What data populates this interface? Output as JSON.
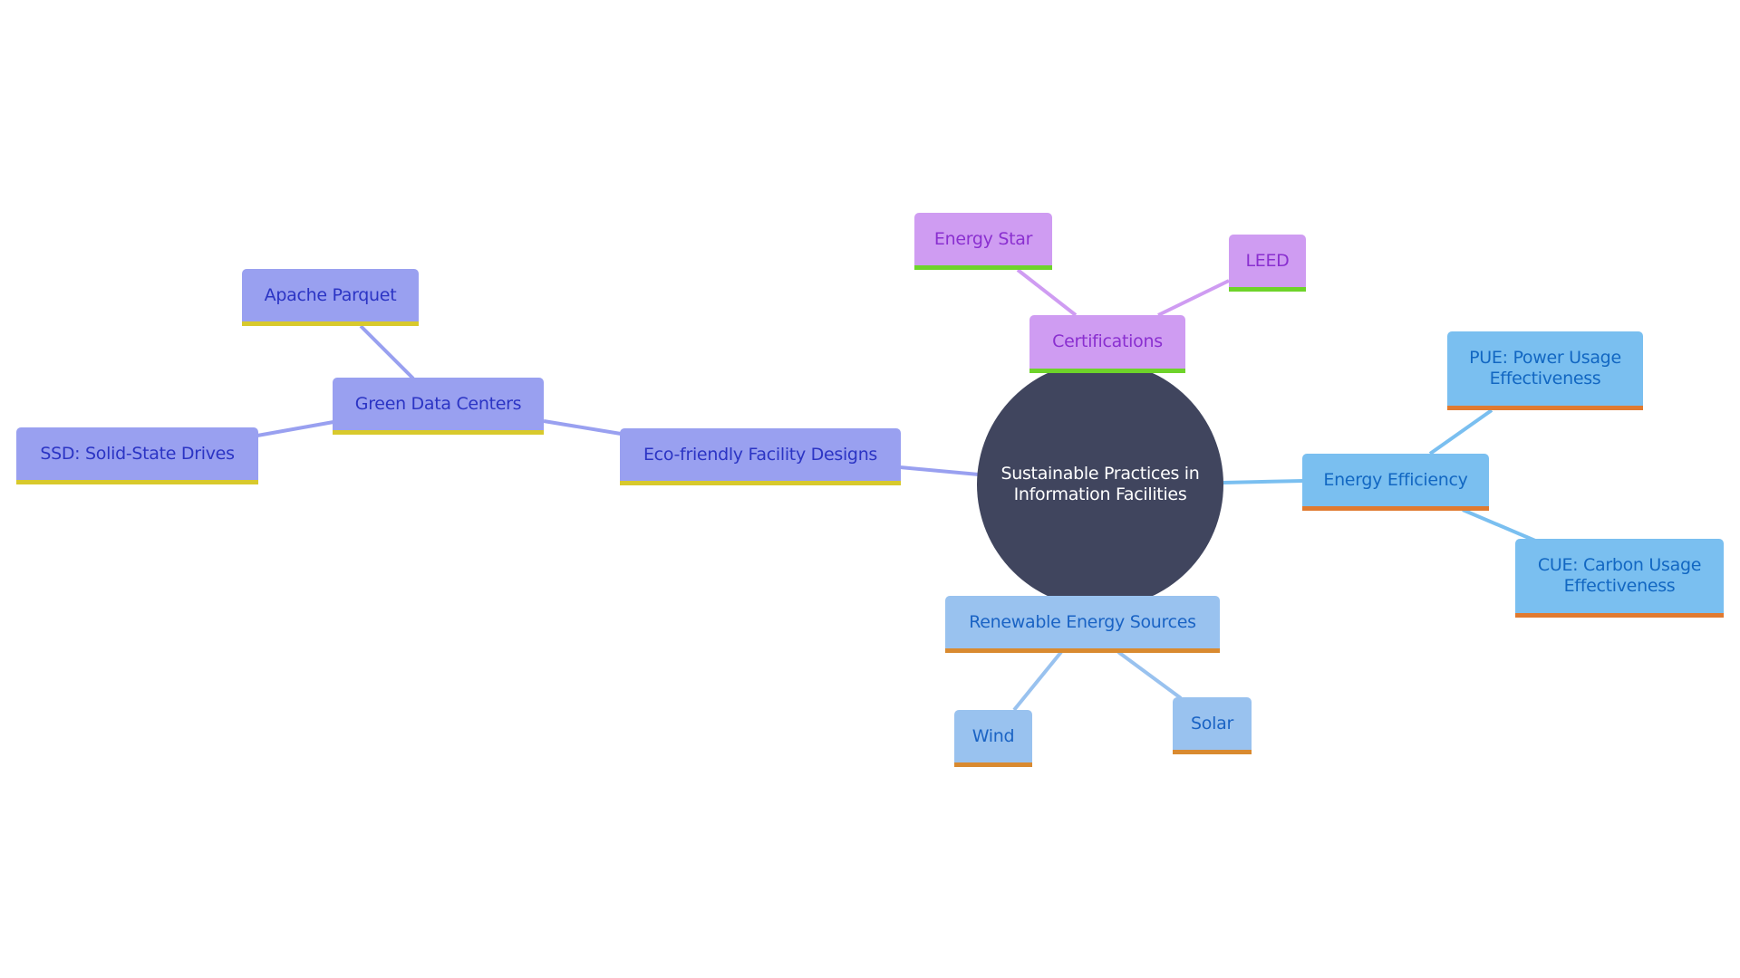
{
  "diagram": {
    "type": "mindmap",
    "root": {
      "label": "Sustainable Practices in Information Facilities",
      "color": "#40455e",
      "text_color": "#ffffff"
    },
    "branches": [
      {
        "id": "eco",
        "label": "Eco-friendly Facility Designs",
        "fill": "#99a0f0",
        "text_color": "#2b34c4",
        "bar": "#d8c92c",
        "edge": "#99a0f0",
        "children": [
          {
            "id": "green",
            "label": "Green Data Centers",
            "children": [
              {
                "id": "parquet",
                "label": "Apache Parquet"
              },
              {
                "id": "ssd",
                "label": "SSD: Solid-State Drives"
              }
            ]
          }
        ]
      },
      {
        "id": "cert",
        "label": "Certifications",
        "fill": "#cf9cf2",
        "text_color": "#8a2fd0",
        "bar": "#6ed32a",
        "edge": "#cf9cf2",
        "children": [
          {
            "id": "estar",
            "label": "Energy Star"
          },
          {
            "id": "leed",
            "label": "LEED"
          }
        ]
      },
      {
        "id": "eff",
        "label": "Energy Efficiency",
        "fill": "#7abff0",
        "text_color": "#1267c2",
        "bar": "#e07a30",
        "edge": "#7abff0",
        "children": [
          {
            "id": "pue",
            "label": "PUE: Power Usage Effectiveness"
          },
          {
            "id": "cue",
            "label": "CUE: Carbon Usage Effectiveness"
          }
        ]
      },
      {
        "id": "ren",
        "label": "Renewable Energy Sources",
        "fill": "#99c2ef",
        "text_color": "#1a63c4",
        "bar": "#d98a30",
        "edge": "#99c2ef",
        "children": [
          {
            "id": "wind",
            "label": "Wind"
          },
          {
            "id": "solar",
            "label": "Solar"
          }
        ]
      }
    ]
  }
}
